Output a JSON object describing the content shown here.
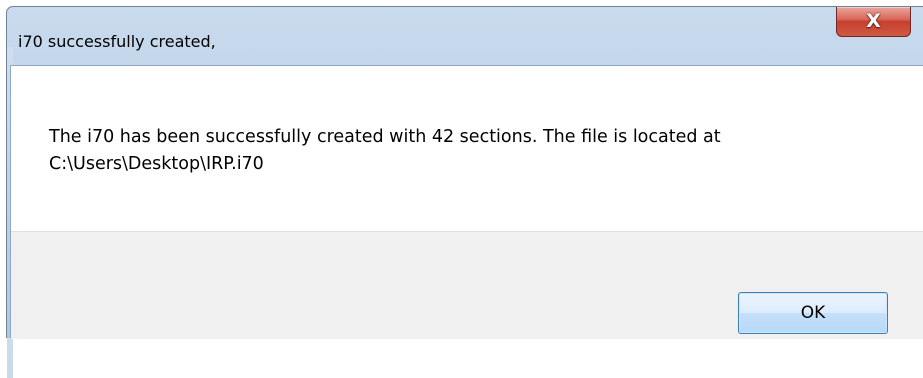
{
  "dialog": {
    "title": "i70 successfully created,",
    "close_glyph": "X",
    "message_line1": "The i70 has been successfully created with 42 sections.  The file is located at",
    "message_line2": "C:\\Users\\Desktop\\IRP.i70",
    "ok_label": "OK"
  },
  "colors": {
    "frame": "#bcd2e8",
    "close_button": "#c6402f",
    "ok_button": "#c4e0fa",
    "footer": "#f0f0f0"
  }
}
